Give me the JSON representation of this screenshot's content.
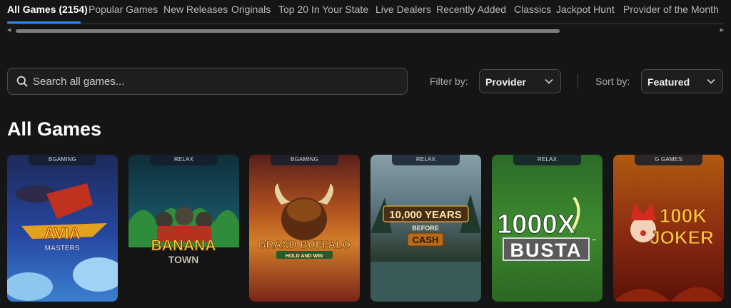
{
  "tabs": [
    {
      "label": "All Games (2154)",
      "active": true
    },
    {
      "label": "Popular Games"
    },
    {
      "label": "New Releases"
    },
    {
      "label": "Originals"
    },
    {
      "label": "Top 20 In Your State"
    },
    {
      "label": "Live Dealers"
    },
    {
      "label": "Recently Added"
    },
    {
      "label": "Classics"
    },
    {
      "label": "Jackpot Hunt"
    },
    {
      "label": "Provider of the Month"
    }
  ],
  "search": {
    "placeholder": "Search all games...",
    "value": ""
  },
  "filter": {
    "label": "Filter by:",
    "selected": "Provider"
  },
  "sort": {
    "label": "Sort by:",
    "selected": "Featured"
  },
  "section_title": "All Games",
  "games": [
    {
      "provider": "BGAMING",
      "title_line1": "AVIA",
      "title_line2": "MASTERS"
    },
    {
      "provider": "RELAX",
      "title_line1": "BANANA",
      "title_line2": "TOWN"
    },
    {
      "provider": "BGAMING",
      "title_line1": "GRAND BUFFALO",
      "title_line2": "HOLD AND WIN"
    },
    {
      "provider": "RELAX",
      "title_line1": "10,000 YEARS",
      "title_line2": "BEFORE",
      "title_line3": "CASH"
    },
    {
      "provider": "RELAX",
      "title_line1": "1000X",
      "title_line2": "BUSTA",
      "title_line3": "™"
    },
    {
      "provider": "G GAMES",
      "title_line1": "100K",
      "title_line2": "JOKER"
    }
  ],
  "colors": {
    "accent": "#2f86e8",
    "background": "#151515"
  },
  "icons": {
    "search": "search-icon",
    "chevron": "chevron-down-icon"
  }
}
